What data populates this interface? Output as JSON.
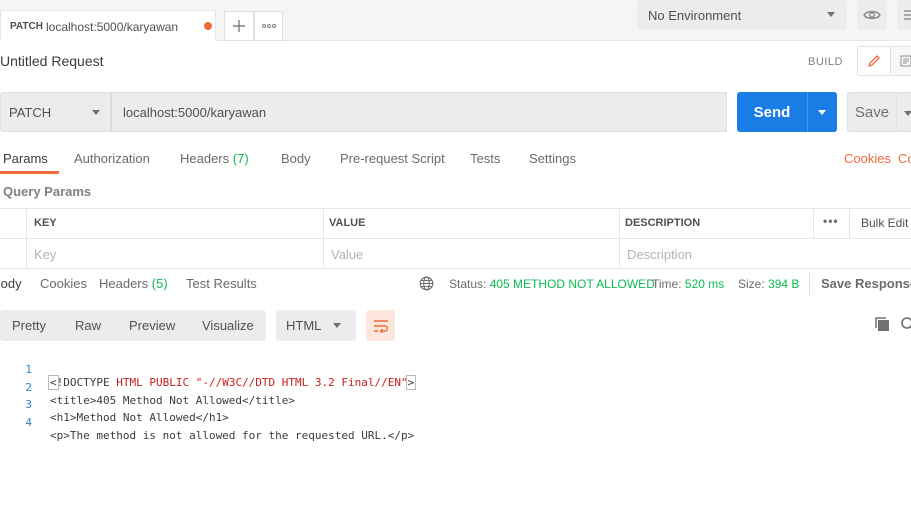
{
  "tab_strip": {
    "request_tab": {
      "method": "PATCH",
      "url": "localhost:5000/karyawan",
      "unsaved": true
    },
    "add_tab_icon": "plus-icon",
    "more_tabs_icon": "ellipsis-icon",
    "environment": "No Environment",
    "env_eye_icon": "eye-icon",
    "env_settings_icon": "settings-icon"
  },
  "request": {
    "title": "Untitled Request",
    "build_label": "BUILD",
    "method": "PATCH",
    "url": "localhost:5000/karyawan",
    "send_label": "Send",
    "save_label": "Save"
  },
  "request_tabs": [
    {
      "label": "Params",
      "active": true
    },
    {
      "label": "Authorization"
    },
    {
      "label": "Headers",
      "count": "(7)"
    },
    {
      "label": "Body"
    },
    {
      "label": "Pre-request Script"
    },
    {
      "label": "Tests"
    },
    {
      "label": "Settings"
    }
  ],
  "request_links": {
    "cookies": "Cookies",
    "code": "Co"
  },
  "query_params": {
    "label": "Query Params",
    "columns": [
      "KEY",
      "VALUE",
      "DESCRIPTION"
    ],
    "more": "•••",
    "bulk_edit": "Bulk Edit",
    "placeholder": {
      "key": "Key",
      "value": "Value",
      "description": "Description"
    }
  },
  "response_tabs": [
    {
      "label": "Body",
      "active": true
    },
    {
      "label": "Cookies"
    },
    {
      "label": "Headers",
      "count": "(5)"
    },
    {
      "label": "Test Results"
    }
  ],
  "response_meta": {
    "status_label": "Status:",
    "status": "405 METHOD NOT ALLOWED",
    "time_label": "Time:",
    "time": "520 ms",
    "size_label": "Size:",
    "size": "394 B",
    "save_response": "Save Response"
  },
  "response_toolbar": {
    "formats": [
      "Pretty",
      "Raw",
      "Preview",
      "Visualize"
    ],
    "active_format": "Pretty",
    "language": "HTML"
  },
  "response_body": {
    "lines": [
      {
        "n": "1",
        "parts": [
          [
            "bracket",
            "<"
          ],
          [
            "tag",
            "!DOCTYPE "
          ],
          [
            "red",
            "HTML PUBLIC \"-//W3C//DTD HTML 3.2 Final//EN\""
          ],
          [
            "bracket",
            ">"
          ]
        ]
      },
      {
        "n": "2",
        "text": "<title>405 Method Not Allowed</title>"
      },
      {
        "n": "3",
        "text": "<h1>Method Not Allowed</h1>"
      },
      {
        "n": "4",
        "text": "<p>The method is not allowed for the requested URL.</p>"
      }
    ]
  },
  "colors": {
    "accent": "#f26b3a",
    "send": "#1a7de6",
    "ok": "#0cbb52"
  }
}
